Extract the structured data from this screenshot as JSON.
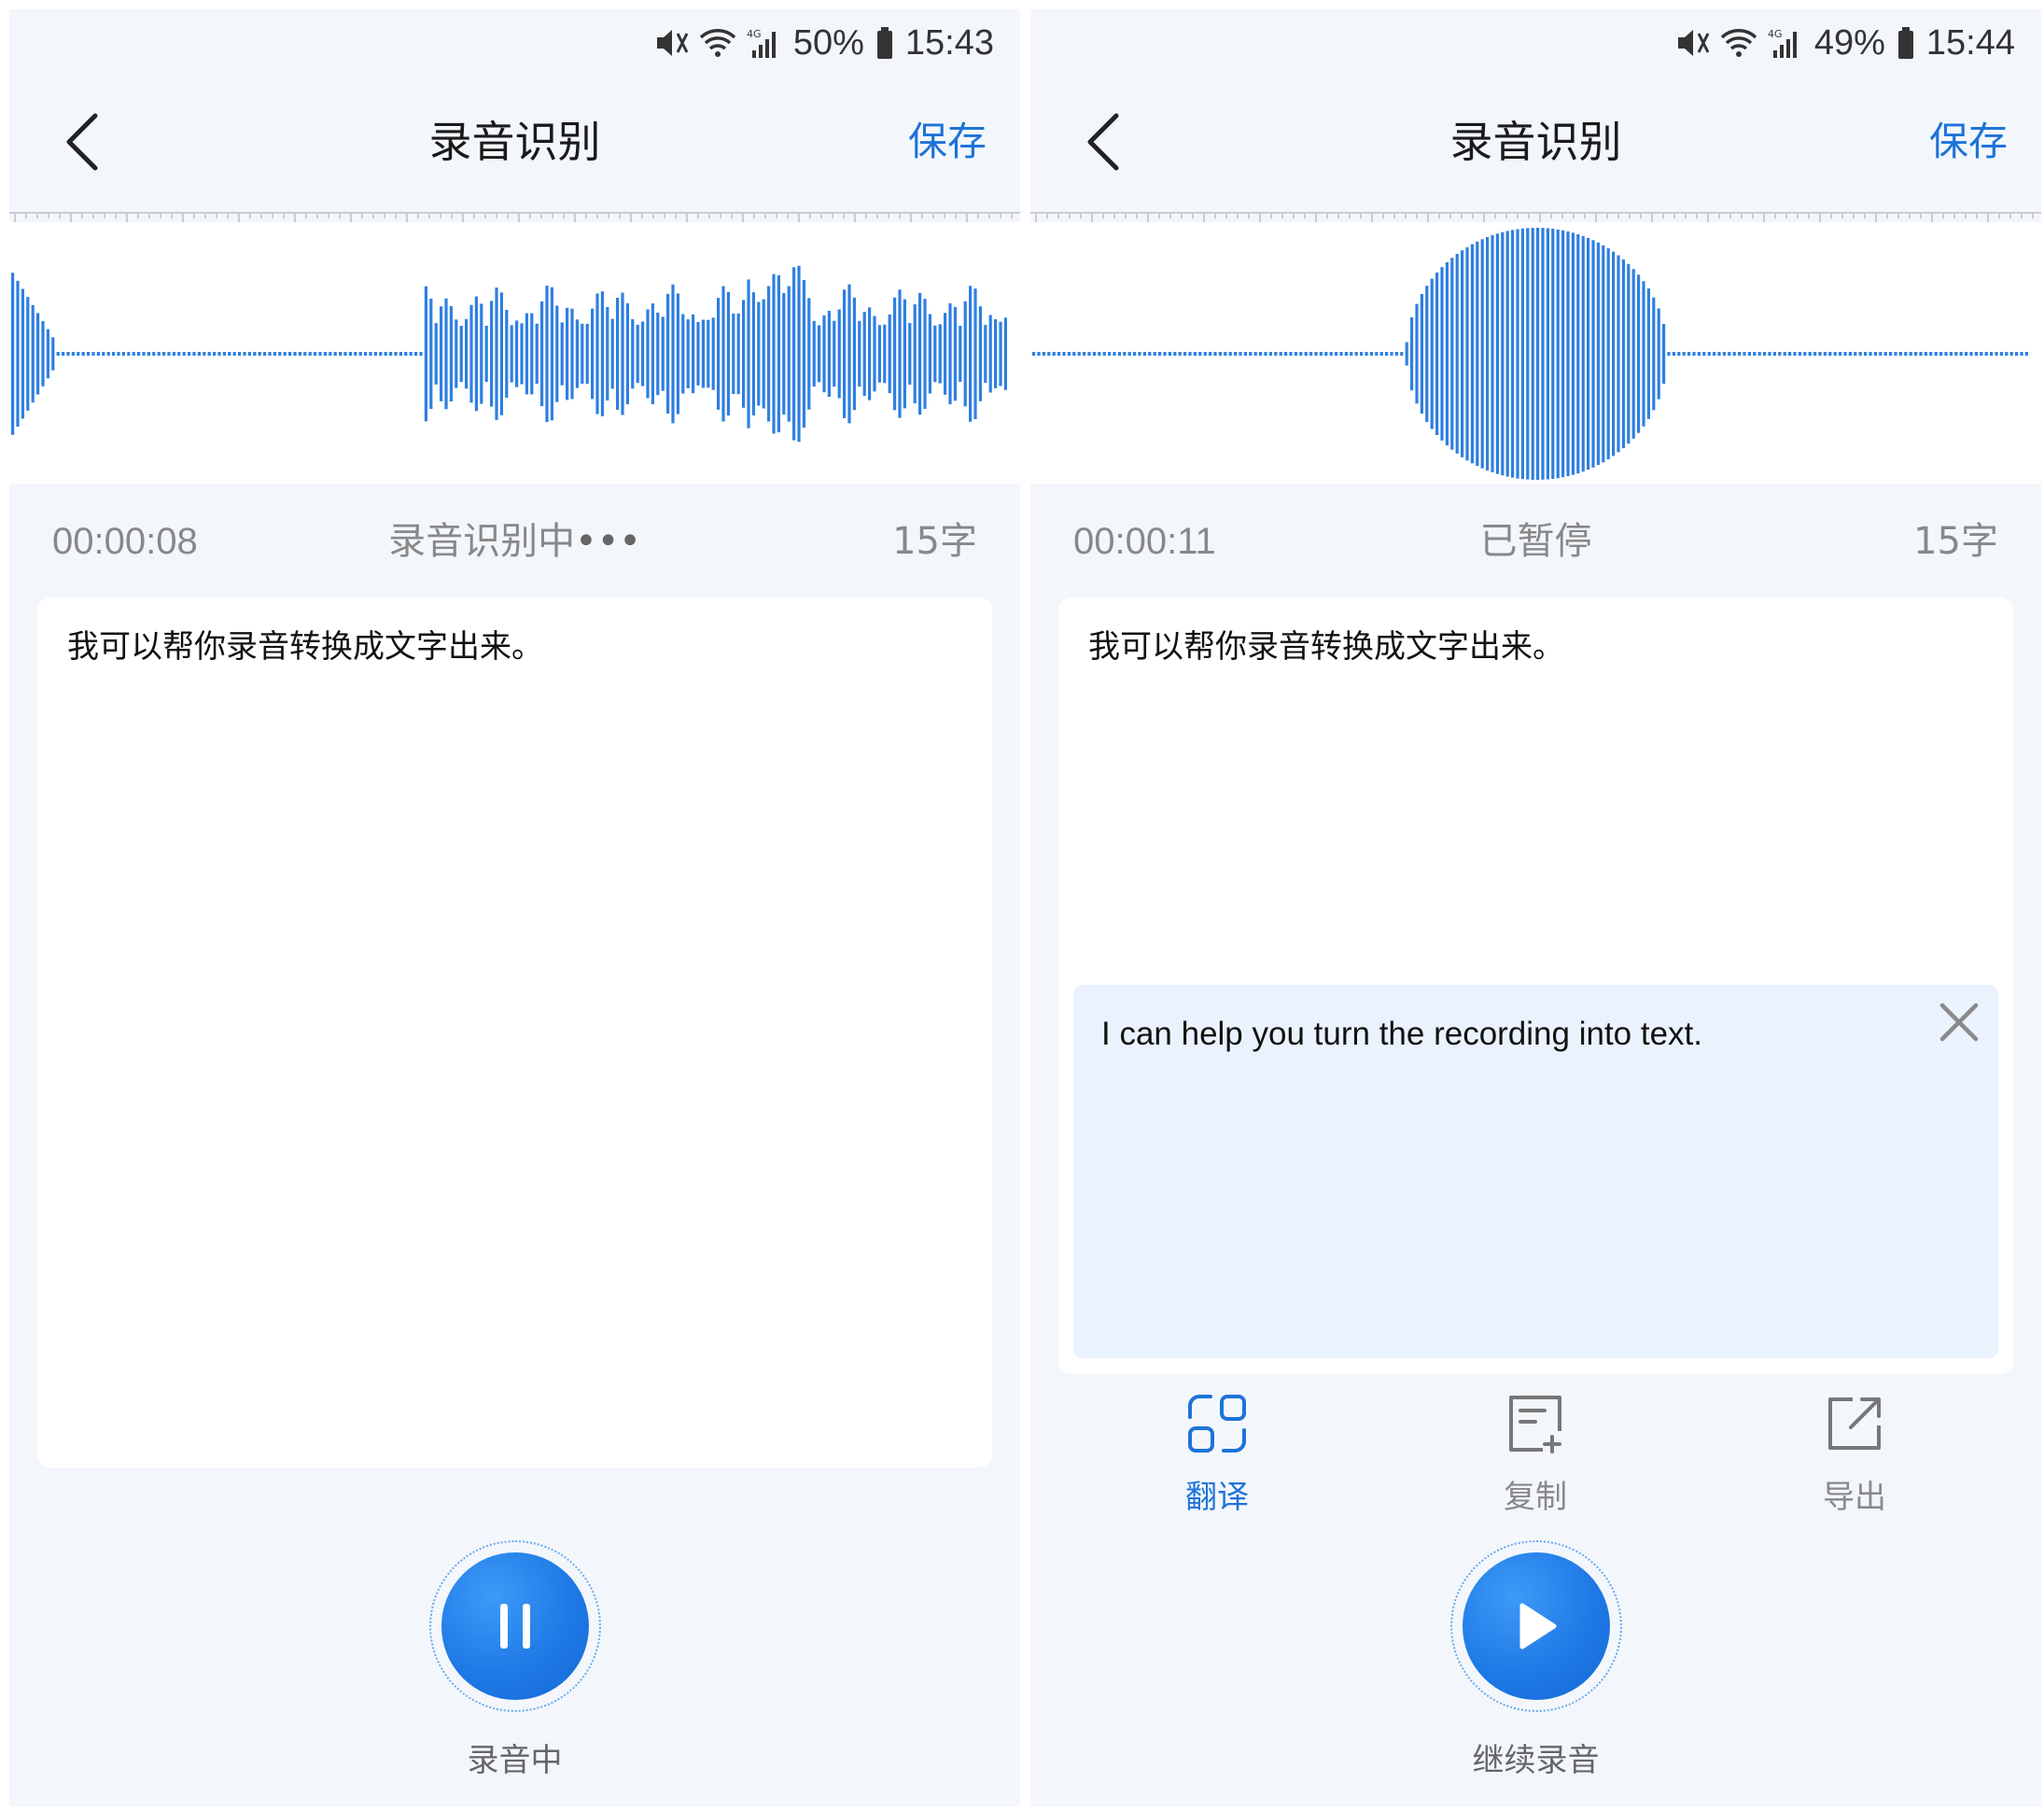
{
  "colors": {
    "accent": "#1e73d8",
    "wave": "#2f7fe0",
    "background": "#f3f7fc",
    "translation_bg": "#eaf2fd"
  },
  "screens": [
    {
      "status": {
        "battery": "50%",
        "time": "15:43",
        "icons": [
          "mute-icon",
          "wifi-icon",
          "4g-signal-icon",
          "battery-icon"
        ]
      },
      "header": {
        "title": "录音识别",
        "save_label": "保存",
        "back_icon": "chevron-left-icon"
      },
      "info": {
        "elapsed": "00:00:08",
        "state": "录音识别中",
        "state_indicator": "•••",
        "char_count": "15字"
      },
      "transcript": "我可以帮你录音转换成文字出来。",
      "control": {
        "icon": "pause-icon",
        "label": "录音中"
      }
    },
    {
      "status": {
        "battery": "49%",
        "time": "15:44",
        "icons": [
          "mute-icon",
          "wifi-icon",
          "4g-signal-icon",
          "battery-icon"
        ]
      },
      "header": {
        "title": "录音识别",
        "save_label": "保存",
        "back_icon": "chevron-left-icon"
      },
      "info": {
        "elapsed": "00:00:11",
        "state": "已暂停",
        "char_count": "15字"
      },
      "transcript": "我可以帮你录音转换成文字出来。",
      "translation": "I can help you turn the recording into text.",
      "actions": [
        {
          "label": "翻译",
          "icon": "translate-scan-icon",
          "active": true
        },
        {
          "label": "复制",
          "icon": "copy-icon",
          "active": false
        },
        {
          "label": "导出",
          "icon": "export-icon",
          "active": false
        }
      ],
      "control": {
        "icon": "play-icon",
        "label": "继续录音"
      }
    }
  ]
}
